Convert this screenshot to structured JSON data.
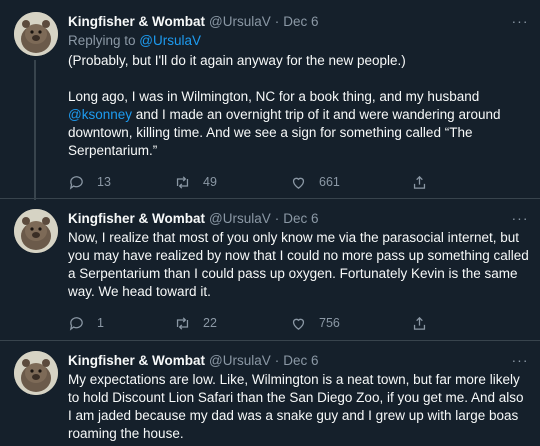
{
  "tweets": [
    {
      "display_name": "Kingfisher & Wombat",
      "handle": "@UrsulaV",
      "sep": "·",
      "date": "Dec 6",
      "replying_prefix": "Replying to ",
      "replying_handle": "@UrsulaV",
      "p1": "(Probably, but I'll do it again anyway for the new people.)",
      "p2_a": "Long ago, I was in Wilmington, NC for a book thing, and my husband ",
      "p2_mention": "@ksonney",
      "p2_b": " and I made an overnight trip of it and were wandering around downtown, killing time. And we see a sign for something called “The Serpentarium.”",
      "replies": "13",
      "retweets": "49",
      "likes": "661"
    },
    {
      "display_name": "Kingfisher & Wombat",
      "handle": "@UrsulaV",
      "sep": "·",
      "date": "Dec 6",
      "body": "Now, I realize that most of you only know me via the parasocial internet, but you may have realized by now that I could no more pass up something called a Serpentarium than I could pass up oxygen. Fortunately Kevin is the same way. We head toward it.",
      "replies": "1",
      "retweets": "22",
      "likes": "756"
    },
    {
      "display_name": "Kingfisher & Wombat",
      "handle": "@UrsulaV",
      "sep": "·",
      "date": "Dec 6",
      "body": "My expectations are low. Like, Wilmington is a neat town, but far more likely to hold Discount Lion Safari than the San Diego Zoo, if you get me. And also I am jaded because my dad was a snake guy and I grew up with large boas roaming the house."
    }
  ],
  "more_glyph": "···",
  "colors": {
    "background": "#15202b",
    "text": "#f7f9f9",
    "muted": "#8b98a5",
    "link": "#1d9bf0",
    "divider": "#38444d"
  },
  "icons": [
    "reply-icon",
    "retweet-icon",
    "like-icon",
    "share-icon",
    "more-icon",
    "wombat-avatar"
  ]
}
